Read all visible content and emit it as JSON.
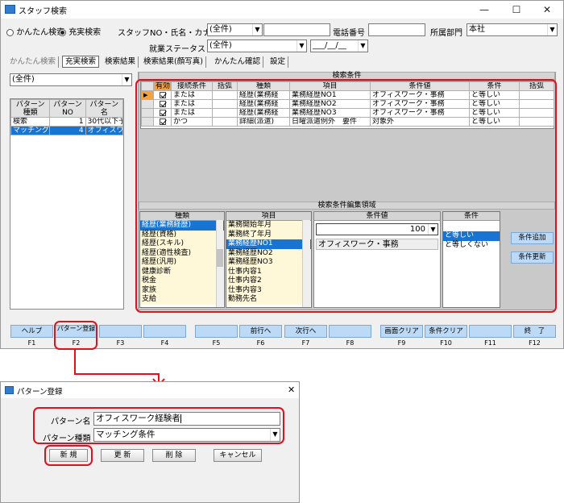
{
  "main_window": {
    "title": "スタッフ検索",
    "controls": {
      "minimize": "—",
      "maximize": "☐",
      "close": "✕"
    },
    "search_mode": {
      "simple": "かんたん検索",
      "full": "充実検索",
      "selected": "full"
    },
    "fields": {
      "staff_label": "スタッフNO・氏名・カナ",
      "staff_select": "(全件)",
      "phone_label": "電話番号",
      "dept_label": "所属部門",
      "dept_value": "本社",
      "status_label": "就業ステータス",
      "status_value": "(全件)",
      "date_value": "___/__/__"
    },
    "tabs": [
      "かんたん検索",
      "充実検索",
      "検索結果",
      "検索結果(顔写真)",
      "かんたん確認",
      "設定"
    ],
    "left_panel": {
      "filter": "(全件)",
      "headers": [
        "パターン種類",
        "パターンNO",
        "パターン名"
      ],
      "rows": [
        [
          "検索",
          "1",
          "30代以下予"
        ],
        [
          "マッチング",
          "4",
          "オフィスワ"
        ]
      ]
    },
    "search_conditions": {
      "title": "検索条件",
      "headers": [
        "",
        "有効",
        "接続条件",
        "括弧",
        "種類",
        "項目",
        "条件値",
        "条件",
        "括弧"
      ],
      "rows": [
        [
          "▶",
          true,
          "または",
          "",
          "経歴(業務経",
          "業務経歴NO1",
          "オフィスワーク・事務",
          "と等しい",
          ""
        ],
        [
          "",
          true,
          "または",
          "",
          "経歴(業務経",
          "業務経歴NO2",
          "オフィスワーク・事務",
          "と等しい",
          ""
        ],
        [
          "",
          true,
          "または",
          "",
          "経歴(業務経",
          "業務経歴NO3",
          "オフィスワーク・事務",
          "と等しい",
          ""
        ],
        [
          "",
          true,
          "かつ",
          "",
          "詳細(派遣)",
          "日曜派遣例外　要件",
          "対象外",
          "と等しい",
          ""
        ]
      ]
    },
    "edit_area": {
      "title": "検索条件編集領域",
      "type_header": "種類",
      "types": [
        "経歴(業務経歴)",
        "経歴(資格)",
        "経歴(スキル)",
        "経歴(適性検査)",
        "経歴(汎用)",
        "健康診断",
        "税金",
        "家族",
        "支給"
      ],
      "item_header": "項目",
      "items": [
        "業務開始年月",
        "業務終了年月",
        "業務経歴NO1",
        "業務経歴NO2",
        "業務経歴NO3",
        "仕事内容1",
        "仕事内容2",
        "仕事内容3",
        "勤務先名"
      ],
      "value_header": "条件値",
      "value_select": "100",
      "value_text": "オフィスワーク・事務",
      "cond_header": "条件",
      "conds": [
        "と等しい",
        "と等しくない"
      ],
      "add_button": "条件追加",
      "update_button": "条件更新"
    },
    "fkeys": [
      {
        "label": "ヘルプ",
        "key": "F1"
      },
      {
        "label": "パターン登録",
        "key": "F2"
      },
      {
        "label": "",
        "key": "F3"
      },
      {
        "label": "",
        "key": "F4"
      },
      {
        "label": "",
        "key": "F5"
      },
      {
        "label": "前行へ",
        "key": "F6"
      },
      {
        "label": "次行へ",
        "key": "F7"
      },
      {
        "label": "",
        "key": "F8"
      },
      {
        "label": "画面クリア",
        "key": "F9"
      },
      {
        "label": "条件クリア",
        "key": "F10"
      },
      {
        "label": "",
        "key": "F11"
      },
      {
        "label": "終　了",
        "key": "F12"
      }
    ]
  },
  "dialog": {
    "title": "パターン登録",
    "close": "✕",
    "name_label": "パターン名",
    "name_value": "オフィスワーク経験者",
    "type_label": "パターン種類",
    "type_value": "マッチング条件",
    "buttons": {
      "new": "新 規",
      "update": "更 新",
      "delete": "削 除",
      "cancel": "キャンセル"
    }
  },
  "colors": {
    "highlight": "#e0101e",
    "selection": "#1874d2",
    "fkey": "#bcd9f5"
  }
}
